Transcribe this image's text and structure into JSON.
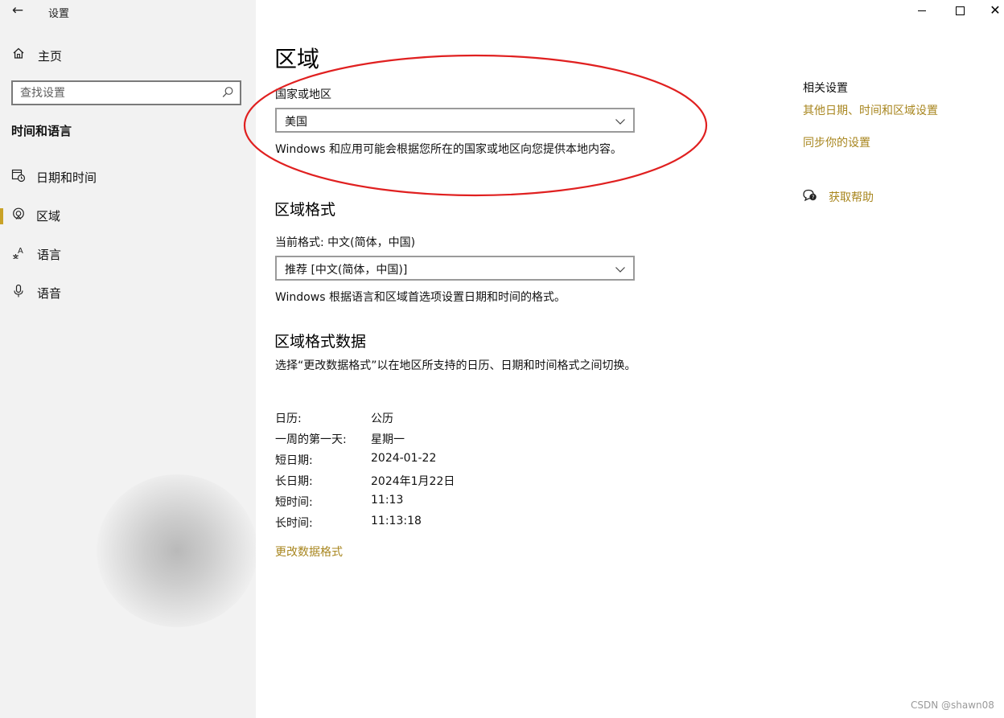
{
  "window": {
    "title": "设置",
    "back_icon": "←",
    "close_icon": "✕"
  },
  "sidebar": {
    "home_label": "主页",
    "search_placeholder": "查找设置",
    "section_title": "时间和语言",
    "items": [
      {
        "label": "日期和时间",
        "icon": "calendar-clock-icon",
        "active": false
      },
      {
        "label": "区域",
        "icon": "globe-icon",
        "active": true
      },
      {
        "label": "语言",
        "icon": "language-icon",
        "active": false
      },
      {
        "label": "语音",
        "icon": "microphone-icon",
        "active": false
      }
    ]
  },
  "main": {
    "title": "区域",
    "country_label": "国家或地区",
    "country_value": "美国",
    "country_desc": "Windows 和应用可能会根据您所在的国家或地区向您提供本地内容。",
    "format_heading": "区域格式",
    "current_format_label": "当前格式: 中文(简体，中国)",
    "format_value": "推荐 [中文(简体，中国)]",
    "format_desc": "Windows 根据语言和区域首选项设置日期和时间的格式。",
    "data_heading": "区域格式数据",
    "data_desc": "选择“更改数据格式”以在地区所支持的日历、日期和时间格式之间切换。",
    "details": [
      {
        "key": "日历:",
        "value": "公历"
      },
      {
        "key": "一周的第一天:",
        "value": "星期一"
      },
      {
        "key": "短日期:",
        "value": "2024-01-22"
      },
      {
        "key": "长日期:",
        "value": "2024年1月22日"
      },
      {
        "key": "短时间:",
        "value": "11:13"
      },
      {
        "key": "长时间:",
        "value": "11:13:18"
      }
    ],
    "change_format_link": "更改数据格式"
  },
  "related": {
    "title": "相关设置",
    "link1": "其他日期、时间和区域设置",
    "link2": "同步你的设置",
    "help_link": "获取帮助"
  },
  "watermark": "CSDN @shawn08",
  "colors": {
    "accent": "#c9a227",
    "link": "#a8861f",
    "sidebar_bg": "#f2f2f2",
    "annotation": "#e02020"
  }
}
